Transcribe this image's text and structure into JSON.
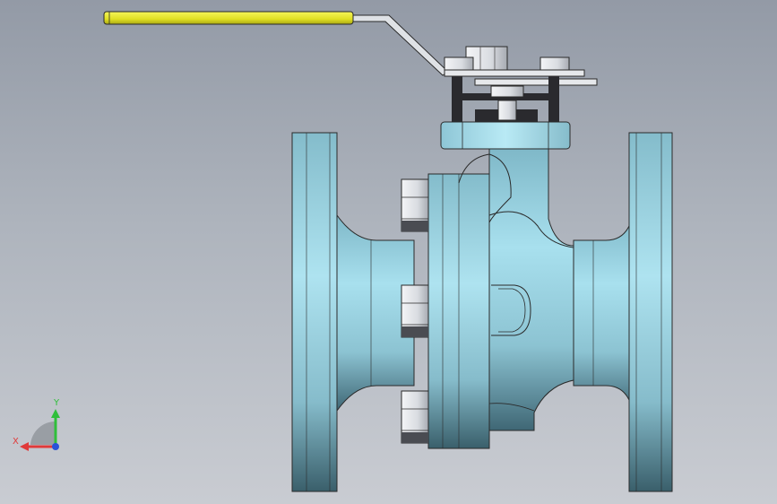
{
  "viewport": {
    "background_top": "#939aa6",
    "background_bottom": "#c9ccd2"
  },
  "model": {
    "body_color": "#9fd6e6",
    "handle_grip_color": "#e6e632",
    "bolt_color": "#e8eaee",
    "dark_part_color": "#2a2a2e"
  },
  "triad": {
    "x_label": "X",
    "y_label": "Y",
    "x_color": "#e03a3a",
    "y_color": "#2fbf3a",
    "z_color": "#2a52d8"
  }
}
